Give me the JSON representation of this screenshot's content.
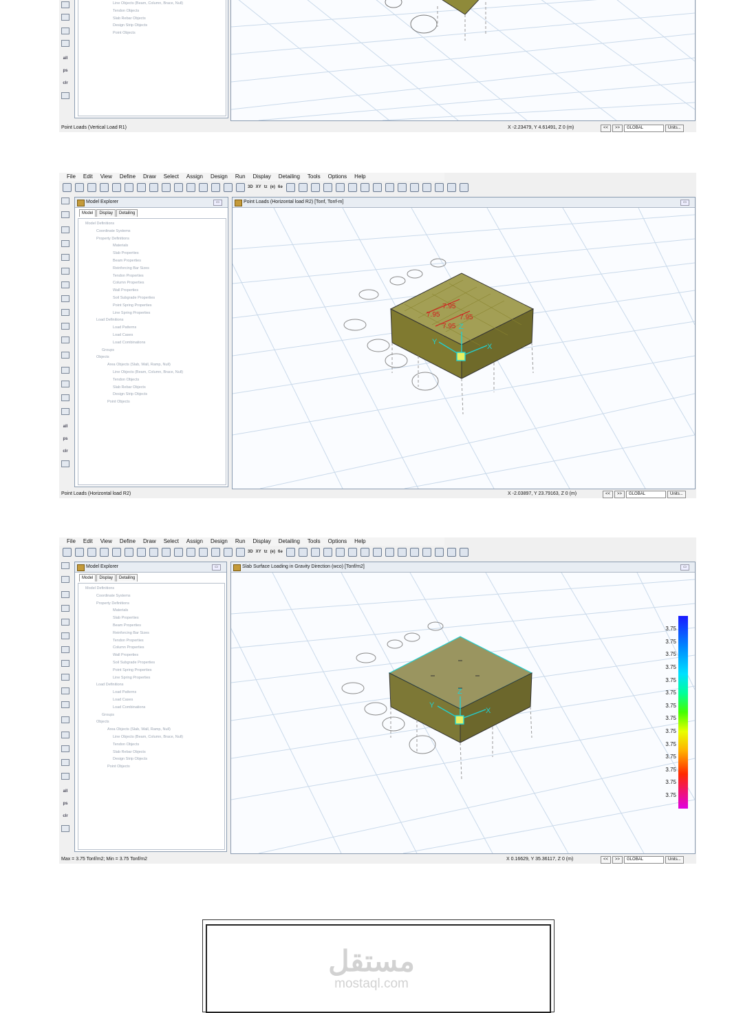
{
  "menu": [
    "File",
    "Edit",
    "View",
    "Define",
    "Draw",
    "Select",
    "Assign",
    "Design",
    "Run",
    "Display",
    "Detailing",
    "Tools",
    "Options",
    "Help"
  ],
  "toolbar_text": {
    "t3d": "3D",
    "txy": "XY",
    "tz": "tz",
    "tsel": "(e)",
    "tall": "6ǝ"
  },
  "left_tool_labels": {
    "all": "all",
    "ps": "ps",
    "clr": "clr"
  },
  "explorer": {
    "title": "Model Explorer",
    "tabs": [
      "Model",
      "Display",
      "Detailing"
    ],
    "tree": [
      "Model Definitions",
      "Coordinate Systems",
      "Property Definitions",
      "Materials",
      "Slab Properties",
      "Beam Properties",
      "Reinforcing Bar Sizes",
      "Tendon Properties",
      "Column Properties",
      "Wall Properties",
      "Soil Subgrade Properties",
      "Point Spring Properties",
      "Line Spring Properties",
      "Load Definitions",
      "Load Patterns",
      "Load Cases",
      "Load Combinations",
      "Groups",
      "Objects",
      "Area Objects (Slab, Wall, Ramp, Null)",
      "Line Objects (Beam, Column, Brace, Null)",
      "Tendon Objects",
      "Slab Rebar Objects",
      "Design Strip Objects",
      "Point Objects"
    ],
    "tree_partial": [
      "Line Objects (Beam, Column, Brace, Null)",
      "Tendon Objects",
      "Slab Rebar Objects",
      "Design Strip Objects",
      "Point Objects"
    ]
  },
  "shots": [
    {
      "status": "Point Loads (Vertical Load R1)",
      "coords": "X -2.23479, Y 4.61491, Z 0 (m)",
      "nav": [
        "<<",
        ">>",
        "GLOBAL",
        "Units..."
      ]
    },
    {
      "viewport_title": "Point Loads (Horizontal load R2) [Tonf, Tonf-m]",
      "status": "Point Loads (Horizontal load R2)",
      "coords": "X -2.03897, Y 23.79163, Z 0 (m)",
      "nav": [
        "<<",
        ">>",
        "GLOBAL",
        "Units..."
      ],
      "load_labels": [
        "7.95",
        "7.95",
        "7.95",
        "7.95"
      ],
      "axis_labels": {
        "x": "X",
        "y": "Y",
        "z": "Z"
      }
    },
    {
      "viewport_title": "Slab Surface Loading in Gravity Direction (wco) [Tonf/m2]",
      "status": "Max = 3.75 Tonf/m2; Min = 3.75 Tonf/m2",
      "coords": "X 0.16629, Y 35.36117, Z 0 (m)",
      "nav": [
        "<<",
        ">>",
        "GLOBAL",
        "Units..."
      ],
      "legend_values": [
        "3.75",
        "3.75",
        "3.75",
        "3.75",
        "3.75",
        "3.75",
        "3.75",
        "3.75",
        "3.75",
        "3.75",
        "3.75",
        "3.75",
        "3.75",
        "3.75"
      ],
      "axis_labels": {
        "x": "X",
        "y": "Y",
        "z": "Z"
      }
    }
  ],
  "watermark": {
    "arabic": "مستقل",
    "latin": "mostaql.com"
  },
  "colors": {
    "box_fill": "#8f8a3a",
    "grid": "#c9d9ea",
    "selection": "#22d0d0",
    "load": "#d02020"
  }
}
